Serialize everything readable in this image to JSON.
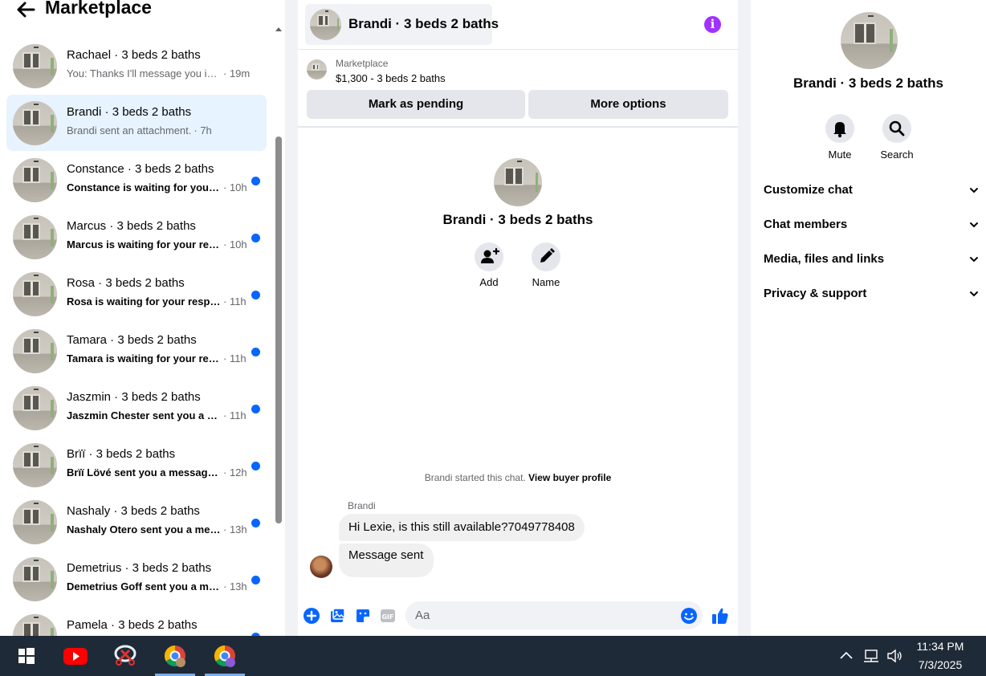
{
  "sidebar": {
    "title": "Marketplace",
    "conversations": [
      {
        "name": "Rachael · 3 beds 2 baths",
        "preview": "You: Thanks I'll message you in a ...",
        "time": "· 19m"
      },
      {
        "name": "Brandi · 3 beds 2 baths",
        "preview": "Brandi sent an attachment.",
        "time": "· 7h"
      },
      {
        "name": "Constance · 3 beds 2 baths",
        "preview": "Constance is waiting for your r...",
        "time": "· 10h"
      },
      {
        "name": "Marcus · 3 beds 2 baths",
        "preview": "Marcus is waiting for your resp...",
        "time": "· 10h"
      },
      {
        "name": "Rosa · 3 beds 2 baths",
        "preview": "Rosa is waiting for your respo...",
        "time": "· 11h"
      },
      {
        "name": "Tamara · 3 beds 2 baths",
        "preview": "Tamara is waiting for your resp...",
        "time": "· 11h"
      },
      {
        "name": "Jaszmin · 3 beds 2 baths",
        "preview": "Jaszmin Chester sent you a me...",
        "time": "· 11h"
      },
      {
        "name": "Brïï · 3 beds 2 baths",
        "preview": "Brïï Lövé sent you a message a...",
        "time": "· 12h"
      },
      {
        "name": "Nashaly · 3 beds 2 baths",
        "preview": "Nashaly Otero sent you a mess...",
        "time": "· 13h"
      },
      {
        "name": "Demetrius · 3 beds 2 baths",
        "preview": "Demetrius Goff sent you a mes...",
        "time": "· 13h"
      },
      {
        "name": "Pamela · 3 beds 2 baths",
        "preview": "",
        "time": ""
      }
    ]
  },
  "chat": {
    "title": "Brandi · 3 beds 2 baths",
    "listing_source": "Marketplace",
    "listing_summary": "$1,300 - 3 beds 2 baths",
    "mark_pending": "Mark as pending",
    "more_options": "More options",
    "intro_name": "Brandi · 3 beds 2 baths",
    "add_label": "Add",
    "name_label": "Name",
    "started_text": "Brandi started this chat.",
    "view_profile": "View buyer profile",
    "sender": "Brandi",
    "messages": [
      "Hi Lexie, is this still available?7049778408",
      "Message sent"
    ],
    "input_placeholder": "Aa"
  },
  "details": {
    "name": "Brandi · 3 beds 2 baths",
    "mute_label": "Mute",
    "search_label": "Search",
    "sections": [
      "Customize chat",
      "Chat members",
      "Media, files and links",
      "Privacy & support"
    ]
  },
  "taskbar": {
    "time": "11:34 PM",
    "date": "7/3/2025"
  },
  "colors": {
    "accent": "#0866ff",
    "active_row": "#e7f3ff",
    "info": "#a033ff",
    "taskbar": "#1f2a38"
  }
}
